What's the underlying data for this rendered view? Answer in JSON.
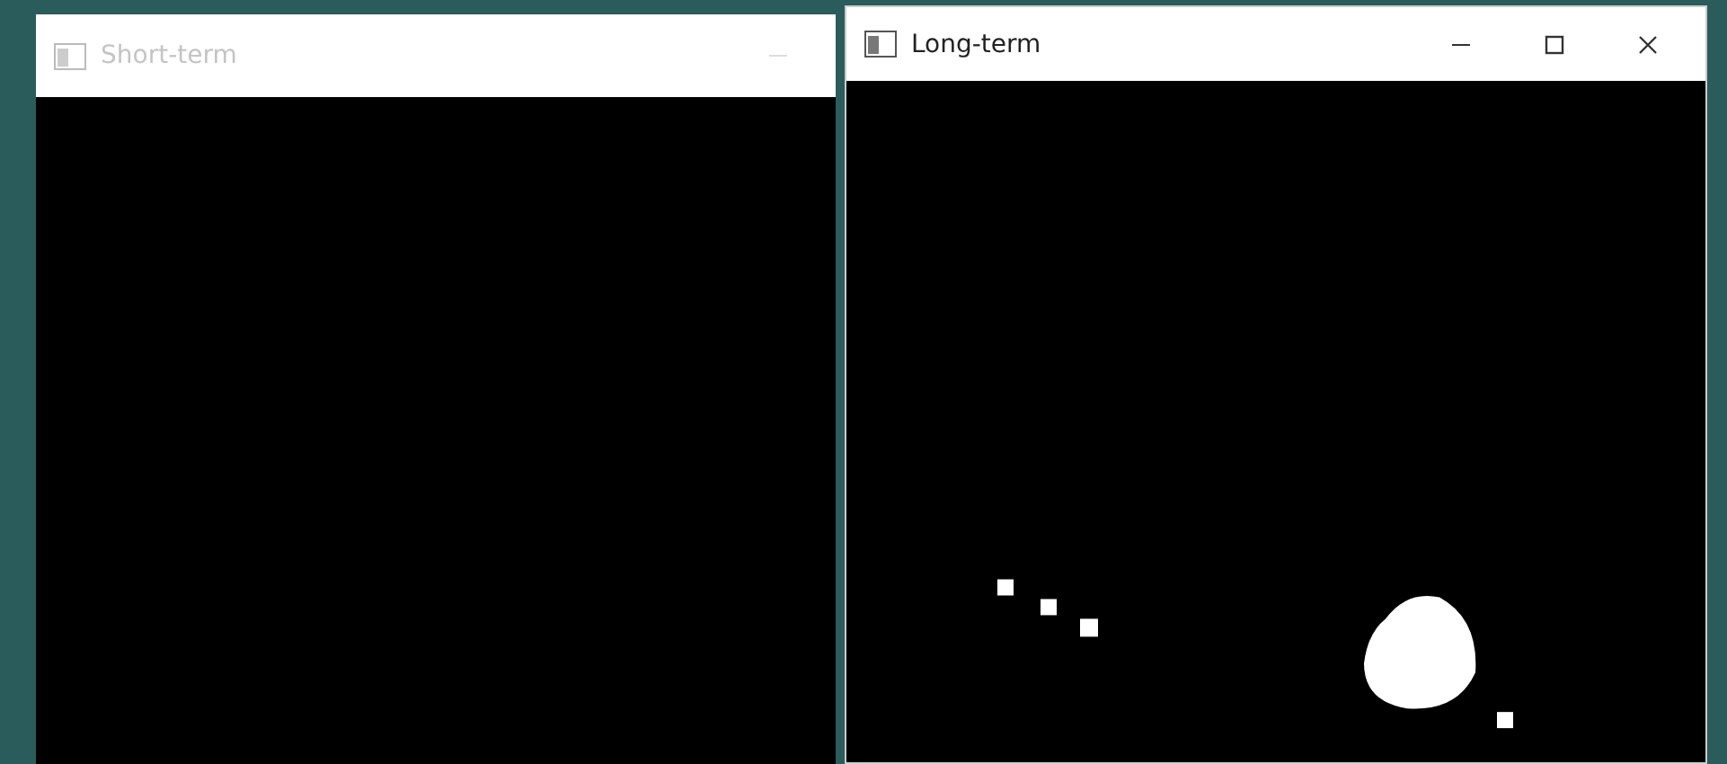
{
  "windows": [
    {
      "title": "Short-term",
      "active": false,
      "buttons": [
        {
          "kind": "minimize"
        }
      ],
      "content": {
        "kind": "empty"
      }
    },
    {
      "title": "Long-term",
      "active": true,
      "buttons": [
        {
          "kind": "minimize"
        },
        {
          "kind": "maximize"
        },
        {
          "kind": "close"
        }
      ]
    }
  ]
}
